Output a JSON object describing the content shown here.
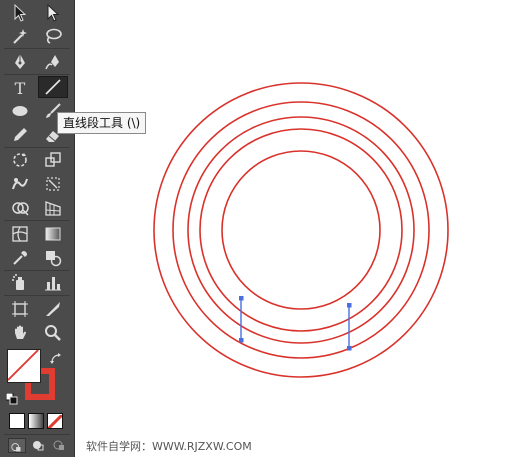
{
  "tooltip": {
    "text": "直线段工具 (\\)"
  },
  "tools": [
    "selection-tool",
    "direct-selection-tool",
    "magic-wand-tool",
    "lasso-tool",
    "pen-tool",
    "blob-brush-tool",
    "type-tool",
    "line-segment-tool",
    "ellipse-tool",
    "paintbrush-tool",
    "pencil-tool",
    "eraser-tool",
    "rotate-tool",
    "scale-tool",
    "warp-tool",
    "free-transform-tool",
    "shape-builder-tool",
    "perspective-grid-tool",
    "mesh-tool",
    "gradient-tool",
    "eyedropper-tool",
    "blend-tool",
    "symbol-sprayer-tool",
    "column-graph-tool",
    "artboard-tool",
    "slice-tool",
    "hand-tool",
    "zoom-tool"
  ],
  "selected_tool": "line-segment-tool",
  "colors": {
    "fill": "#ffffff",
    "stroke": "#e03c31",
    "circle_stroke": "#d9322b",
    "selection": "#4a6ee0"
  },
  "watermark": "软件自学网：WWW.RJZXW.COM"
}
